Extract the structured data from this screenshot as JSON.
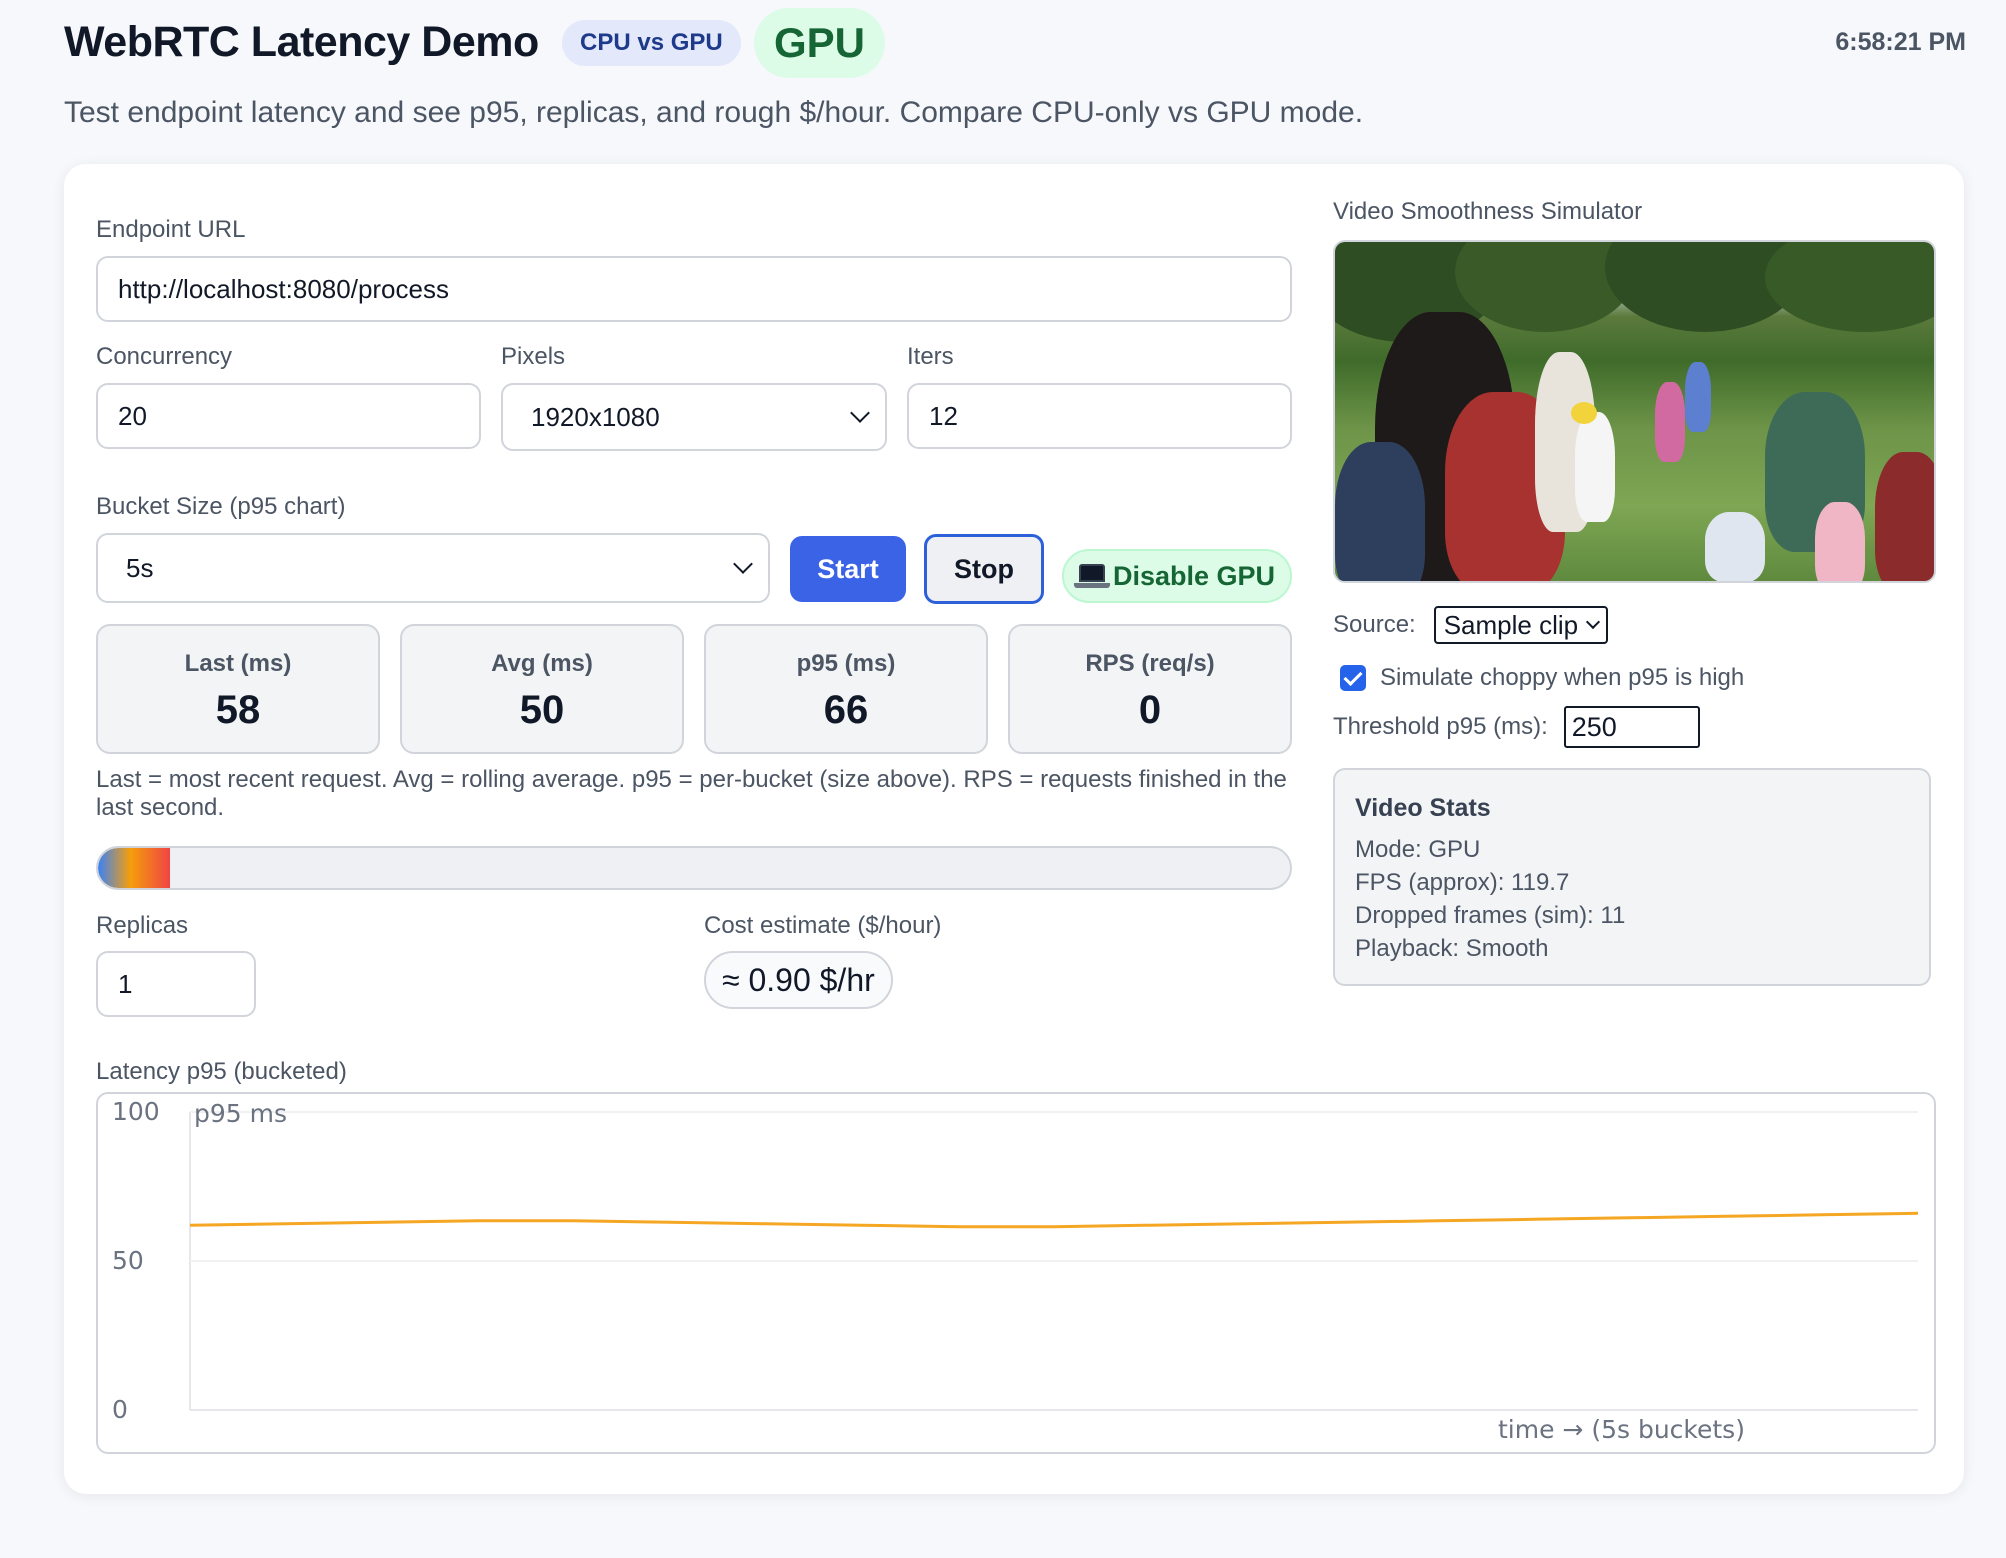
{
  "header": {
    "title": "WebRTC Latency Demo",
    "badge_compare": "CPU vs GPU",
    "badge_mode": "GPU",
    "clock": "6:58:21 PM",
    "subtitle": "Test endpoint latency and see p95, replicas, and rough $/hour. Compare CPU-only vs GPU mode."
  },
  "form": {
    "endpoint_label": "Endpoint URL",
    "endpoint_value": "http://localhost:8080/process",
    "concurrency_label": "Concurrency",
    "concurrency_value": "20",
    "pixels_label": "Pixels",
    "pixels_value": "1920x1080",
    "iters_label": "Iters",
    "iters_value": "12",
    "bucket_label": "Bucket Size (p95 chart)",
    "bucket_value": "5s"
  },
  "buttons": {
    "start": "Start",
    "stop": "Stop",
    "gpu_toggle": "Disable GPU"
  },
  "stats": [
    {
      "label": "Last (ms)",
      "value": "58"
    },
    {
      "label": "Avg (ms)",
      "value": "50"
    },
    {
      "label": "p95 (ms)",
      "value": "66"
    },
    {
      "label": "RPS (req/s)",
      "value": "0"
    }
  ],
  "stats_note": "Last = most recent request. Avg = rolling average. p95 = per-bucket (size above). RPS = requests finished in the last second.",
  "load_bar": {
    "fraction": 0.06
  },
  "replicas": {
    "label": "Replicas",
    "value": "1"
  },
  "cost": {
    "label": "Cost estimate ($/hour)",
    "value": "≈ 0.90 $/hr"
  },
  "video": {
    "section_title": "Video Smoothness Simulator",
    "source_label": "Source:",
    "source_value": "Sample clip",
    "choppy_label": "Simulate choppy when p95 is high",
    "choppy_checked": true,
    "threshold_label": "Threshold p95 (ms):",
    "threshold_value": "250",
    "stats_title": "Video Stats",
    "stats_lines": [
      "Mode: GPU",
      "FPS (approx): 119.7",
      "Dropped frames (sim): 11",
      "Playback: Smooth"
    ]
  },
  "chart_section_title": "Latency p95 (bucketed)",
  "colors": {
    "accent": "#3b63e6",
    "gpu_green": "#166534",
    "line": "#f5a623"
  },
  "chart_data": {
    "type": "line",
    "title": "",
    "ylabel": "p95 ms",
    "xlabel": "time → (5s buckets)",
    "ylim": [
      0,
      100
    ],
    "yticks": [
      0,
      50,
      100
    ],
    "grid": true,
    "series": [
      {
        "values": [
          62,
          62.5,
          63,
          63.5,
          63.5,
          63,
          62.5,
          62,
          61.5,
          61.5,
          62,
          62.5,
          63,
          63.5,
          64,
          64.5,
          65,
          65.5,
          66
        ]
      }
    ]
  }
}
